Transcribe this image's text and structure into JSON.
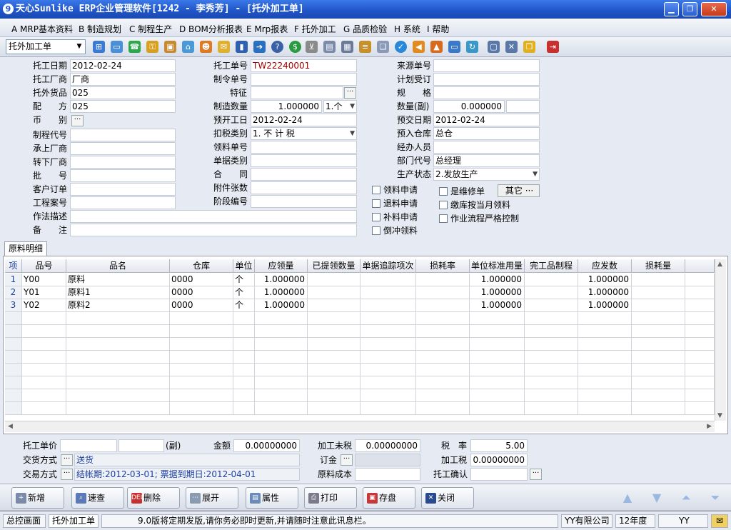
{
  "window": {
    "title": "天心Sunlike ERP企业管理软件[1242 - 李秀芳] - [托外加工单]"
  },
  "menu": [
    {
      "label": "A MRP基本资料"
    },
    {
      "label": "B 制造规划"
    },
    {
      "label": "C 制程生产"
    },
    {
      "label": "D BOM分析报表"
    },
    {
      "label": "E Mrp报表"
    },
    {
      "label": "F 托外加工"
    },
    {
      "label": "G 品质检验"
    },
    {
      "label": "H 系统"
    },
    {
      "label": "I 帮助"
    }
  ],
  "toolbar": {
    "module_value": "托外加工单"
  },
  "form": {
    "col1": {
      "tuogong_riqi": {
        "label": "托工日期",
        "value": "2012-02-24"
      },
      "tuogong_changshang": {
        "label": "托工厂商",
        "value": "厂商"
      },
      "tuowai_huopin": {
        "label": "托外货品",
        "value": "025"
      },
      "peifang": {
        "label": "配　　方",
        "value": "025"
      },
      "bibie": {
        "label": "币　　别"
      },
      "zhichengdaihao": {
        "label": "制程代号",
        "value": ""
      },
      "chengshang": {
        "label": "承上厂商",
        "value": ""
      },
      "zhuanxia": {
        "label": "转下厂商",
        "value": ""
      },
      "pihao": {
        "label": "批　　号",
        "value": ""
      },
      "kehudingdan": {
        "label": "客户订单",
        "value": ""
      },
      "gongchenganhao": {
        "label": "工程案号",
        "value": ""
      },
      "zuofamiaoshu": {
        "label": "作法描述",
        "value": ""
      },
      "beizhu": {
        "label": "备　　注",
        "value": ""
      }
    },
    "col2": {
      "tuogong_danhao": {
        "label": "托工单号",
        "value": "TW22240001"
      },
      "zhiling_danhao": {
        "label": "制令单号",
        "value": ""
      },
      "tezheng": {
        "label": "特征",
        "value": ""
      },
      "zhizao_shuliang": {
        "label": "制造数量",
        "value": "1.000000",
        "unit": "1.个"
      },
      "yukai_ri": {
        "label": "预开工日",
        "value": "2012-02-24"
      },
      "koushui_leibie": {
        "label": "扣税类别",
        "value": "1. 不 计 税"
      },
      "lingliao_danhao": {
        "label": "领料单号",
        "value": ""
      },
      "danju_leibie": {
        "label": "单据类别",
        "value": ""
      },
      "hetong": {
        "label": "合　　同",
        "value": ""
      },
      "fujian_zhangshu": {
        "label": "附件张数",
        "value": ""
      },
      "jieduan_bianhao": {
        "label": "阶段编号",
        "value": ""
      }
    },
    "col3": {
      "laiyuan_danhao": {
        "label": "来源单号",
        "value": ""
      },
      "jihua_shoudìng": {
        "label": "计划受订",
        "value": ""
      },
      "guige": {
        "label": "规　　格",
        "value": ""
      },
      "shuliang_fu": {
        "label": "数量(副)",
        "value": "0.000000"
      },
      "yujiao_riqi": {
        "label": "预交日期",
        "value": "2012-02-24"
      },
      "yuru_cangku": {
        "label": "预入仓库",
        "value": "总仓"
      },
      "jingban_renyuan": {
        "label": "经办人员",
        "value": ""
      },
      "bumen_daihao": {
        "label": "部门代号",
        "value": "总经理"
      },
      "shengchan_zhuangtai": {
        "label": "生产状态",
        "value": "2.发放生产"
      }
    },
    "checks": {
      "lingliao_shenqing": "领料申请",
      "tuiliao_shenqing": "退料申请",
      "buliao_shenqing": "补料申请",
      "daochong_lingliao": "倒冲领料",
      "shi_weixiudan": "是维修单",
      "jiaoku_dangyue": "缴库按当月领料",
      "zuoye_liucheng": "作业流程严格控制",
      "qita_label": "其它"
    }
  },
  "tabs": [
    {
      "label": "原料明细"
    }
  ],
  "grid": {
    "headers": [
      "项",
      "品号",
      "品名",
      "仓库",
      "单位",
      "应领量",
      "已提领数量",
      "单据追踪项次",
      "损耗率",
      "单位标准用量",
      "完工品制程",
      "应发数",
      "损耗量"
    ],
    "rows": [
      {
        "no": "1",
        "code": "Y00",
        "name": "原料",
        "wh": "0000",
        "unit": "个",
        "qty": "1.000000",
        "std": "1.000000",
        "issue": "1.000000"
      },
      {
        "no": "2",
        "code": "Y01",
        "name": "原料1",
        "wh": "0000",
        "unit": "个",
        "qty": "1.000000",
        "std": "1.000000",
        "issue": "1.000000"
      },
      {
        "no": "3",
        "code": "Y02",
        "name": "原料2",
        "wh": "0000",
        "unit": "个",
        "qty": "1.000000",
        "std": "1.000000",
        "issue": "1.000000"
      }
    ]
  },
  "footer": {
    "tuogong_danjia": {
      "label": "托工单价",
      "value": "",
      "value2": "",
      "fu": "(副)"
    },
    "jine": {
      "label": "金额",
      "value": "0.00000000"
    },
    "jiagong_weishui": {
      "label": "加工未税",
      "value": "0.00000000"
    },
    "shuilv": {
      "label": "税　率",
      "value": "5.00"
    },
    "jiaohuo_fangshi": {
      "label": "交货方式",
      "value": "送货"
    },
    "dingjin": {
      "label": "订金",
      "value": ""
    },
    "jiagongshui": {
      "label": "加工税",
      "value": "0.00000000"
    },
    "jiaoyi_fangshi": {
      "label": "交易方式",
      "value": "结帐期:2012-03-01; 票据到期日:2012-04-01"
    },
    "yuanliao_chengben": {
      "label": "原料成本",
      "value": ""
    },
    "tuogong_queren": {
      "label": "托工确认",
      "value": ""
    }
  },
  "actions": {
    "add": "新增",
    "query": "速查",
    "delete": "删除",
    "expand": "展开",
    "props": "属性",
    "print": "打印",
    "save": "存盘",
    "close": "关闭"
  },
  "status": {
    "home_tab": "总控画面",
    "current_tab": "托外加工单",
    "message": "9.0版将定期发版,请你务必即时更新,并请随时注意此讯息栏。",
    "company": "YY有限公司",
    "year": "12年度",
    "user": "YY"
  }
}
